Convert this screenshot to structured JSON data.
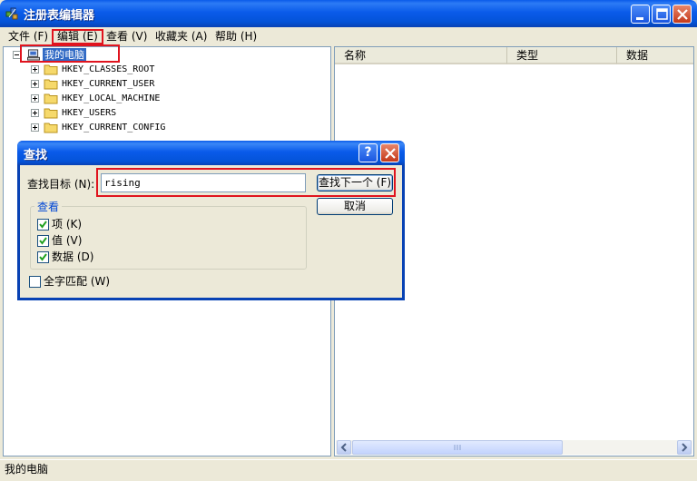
{
  "window": {
    "title": "注册表编辑器"
  },
  "menu": [
    "文件 (F)",
    "编辑 (E)",
    "查看 (V)",
    "收藏夹 (A)",
    "帮助 (H)"
  ],
  "tree": {
    "root": "我的电脑",
    "children": [
      "HKEY_CLASSES_ROOT",
      "HKEY_CURRENT_USER",
      "HKEY_LOCAL_MACHINE",
      "HKEY_USERS",
      "HKEY_CURRENT_CONFIG"
    ]
  },
  "list": {
    "columns": [
      "名称",
      "类型",
      "数据"
    ]
  },
  "status": "我的电脑",
  "find_dialog": {
    "title": "查找",
    "help": "?",
    "target_label": "查找目标 (N):",
    "target_value": "rising",
    "find_next": "查找下一个 (F)",
    "cancel": "取消",
    "look_in_label": "查看",
    "options": [
      {
        "label": "项 (K)",
        "checked": true
      },
      {
        "label": "值 (V)",
        "checked": true
      },
      {
        "label": "数据 (D)",
        "checked": true
      }
    ],
    "whole_match": {
      "label": "全字匹配 (W)",
      "checked": false
    }
  },
  "colors": {
    "title_blue": "#0A5BEA",
    "highlight_red": "#E0141E",
    "selection": "#316AC5"
  }
}
